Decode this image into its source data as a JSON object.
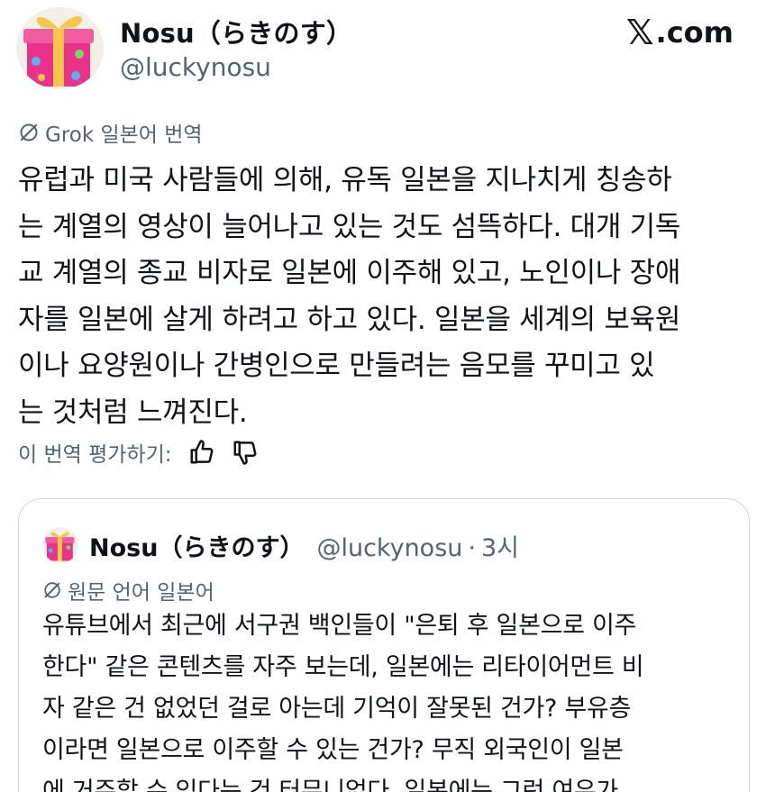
{
  "author": {
    "display_name": "Nosu（らきのす）",
    "handle": "@luckynosu",
    "avatar_icon": "gift-box-avatar-icon"
  },
  "brand": {
    "label": ".com",
    "mark": "𝕏"
  },
  "translation": {
    "label": "Grok 일본어 번역",
    "lines": [
      "유럽과 미국 사람들에 의해, 유독 일본을 지나치게 칭송하",
      "는 계열의 영상이 늘어나고 있는 것도 섬뜩하다. 대개 기독",
      "교 계열의 종교 비자로 일본에 이주해 있고, 노인이나 장애",
      "자를 일본에 살게 하려고 하고 있다. 일본을 세계의 보육원",
      "이나 요양원이나 간병인으로 만들려는 음모를 꾸미고 있",
      "는 것처럼 느껴진다."
    ],
    "rate_label": "이 번역 평가하기:"
  },
  "quote": {
    "display_name": "Nosu（らきのす）",
    "handle": "@luckynosu",
    "separator": "·",
    "time": "3시",
    "lang_label": "원문 언어 일본어",
    "lines": [
      "유튜브에서 최근에 서구권 백인들이 \"은퇴 후 일본으로 이주",
      "한다\" 같은 콘텐츠를 자주 보는데, 일본에는 리타이어먼트 비",
      "자 같은 건 없었던 걸로 아는데 기억이 잘못된 건가? 부유층",
      "이라면 일본으로 이주할 수 있는 건가? 무직 외국인이 일본",
      "에 거주할 수 있다는 건 터무니없다. 일본에는 그런 여유가..."
    ]
  },
  "colors": {
    "text": "#0f1419",
    "secondary": "#536471",
    "border": "#cfd9de"
  }
}
